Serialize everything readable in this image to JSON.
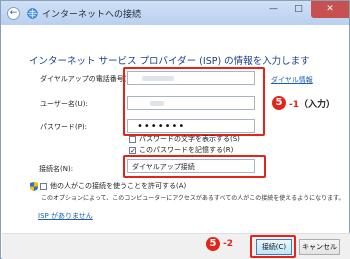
{
  "window": {
    "title": "インターネットへの接続",
    "caption": {
      "minimize": "—",
      "maximize": "□",
      "close": "✕"
    }
  },
  "heading": "インターネット サービス プロバイダー (ISP) の情報を入力します",
  "form": {
    "phone_label": "ダイヤルアップの電話番号(D):",
    "user_label": "ユーザー名(U):",
    "password_label": "パスワード(P):",
    "password_dots": "•••••••",
    "dial_rules_link": "ダイヤル情報",
    "show_chars": "パスワードの文字を表示する(S)",
    "remember": "このパスワードを記憶する(R)",
    "remember_check": "✓",
    "name_label": "接続名(N):",
    "name_value": "ダイヤルアップ接続",
    "share": "他の人がこの接続を使うことを許可する(A)",
    "share_desc": "このオプションによって、このコンピューターにアクセスがあるすべての人がこの接続を使えるようになります。",
    "no_isp_link": "ISP がありません"
  },
  "annotations": {
    "step1_num": "5",
    "step1_text": "-1",
    "step1_paren": "（入力）",
    "step2_num": "5",
    "step2_text": "-2"
  },
  "buttons": {
    "connect": "接続(C)",
    "cancel": "キャンセル"
  },
  "colors": {
    "highlight": "#e2241a",
    "heading": "#1a3f8a",
    "link": "#1a5fb4"
  }
}
